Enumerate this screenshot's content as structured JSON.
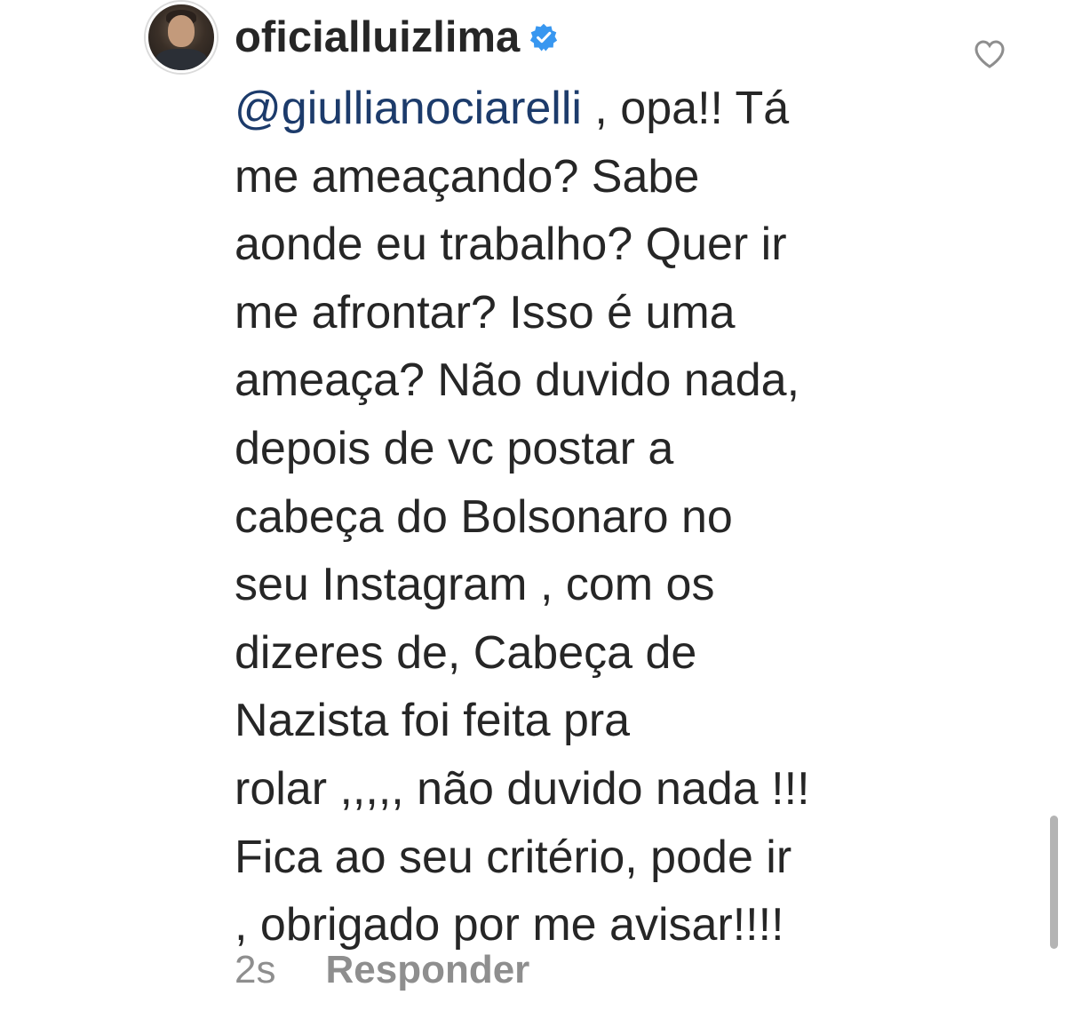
{
  "comment": {
    "username": "oficialluizlima",
    "verified_icon": "verified-badge-icon",
    "like_icon": "heart-outline-icon",
    "mention": "@giullianociarelli",
    "lines": [
      " , opa!! Tá",
      "me ameaçando? Sabe",
      "aonde eu trabalho? Quer ir",
      "me afrontar? Isso é uma",
      "ameaça? Não duvido nada,",
      "depois de vc postar a",
      "cabeça do Bolsonaro no",
      "seu Instagram , com os",
      "dizeres de, Cabeça de",
      "Nazista foi feita pra",
      "rolar ,,,,, não duvido nada !!!",
      "Fica ao seu critério, pode ir",
      ", obrigado por me avisar!!!!"
    ],
    "timestamp": "2s",
    "reply_label": "Responder"
  },
  "colors": {
    "text": "#262626",
    "mention": "#1c3b6b",
    "secondary": "#8e8e8e",
    "verified": "#3897f0"
  }
}
